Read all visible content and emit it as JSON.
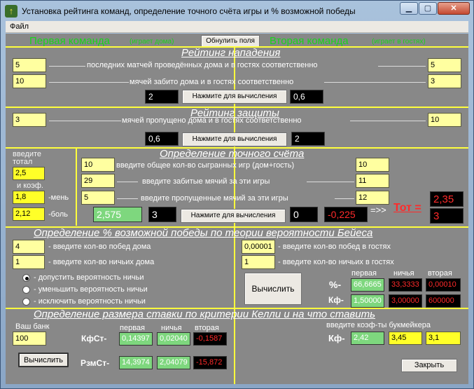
{
  "window": {
    "title": "Установка рейтинга команд, определение точного счёта игры и % возможной победы",
    "min_glyph": "▁",
    "max_glyph": "▢",
    "close_glyph": "✕"
  },
  "menu": {
    "file": "Файл"
  },
  "teams": {
    "first": "Первая команда",
    "first_note": "(играет дома)",
    "reset": "Обнулить поля",
    "second": "Вторая команда",
    "second_note": "(играет в гостях)"
  },
  "attack": {
    "title": "Рейтинг нападения",
    "matches_label": "последних матчей проведённых дома и в гостях соответственно",
    "goals_label": "мячей забито дома и в гостях соответственно",
    "home_matches": "5",
    "home_goals": "10",
    "away_matches": "5",
    "away_goals": "3",
    "result_home": "2",
    "result_away": "0,6",
    "calc_button": "Нажмите для вычисления"
  },
  "defense": {
    "title": "Рейтинг защиты",
    "conceded_label": "мячей пропущено дома и в гостях соответственно",
    "home_conceded": "3",
    "away_conceded": "10",
    "result_home": "0,6",
    "result_away": "2",
    "calc_button": "Нажмите для вычисления"
  },
  "score": {
    "title": "Определение точного счёта",
    "total_label_1": "введите",
    "total_label_2": "тотал",
    "total": "2,5",
    "coef_label": "и коэф.",
    "coef_less": "1,8",
    "less_label": "-мень",
    "coef_more": "2,12",
    "more_label": "-боль",
    "games_label": "введите общее кол-во сыгранных игр (дом+гость)",
    "scored_label": "введите  забитые мячий за эти игры",
    "conceded_label": "введите  пропущенные мячий за эти игры",
    "home_games": "10",
    "home_scored": "29",
    "home_conceded": "5",
    "away_games": "10",
    "away_scored": "11",
    "away_conceded": "12",
    "result_green": "2,575",
    "result_black": "3",
    "calc_button": "Нажмите для вычисления",
    "result_zero": "0",
    "result_red": "-0,225",
    "arrow": "=>>",
    "tot_label": "Тот =",
    "tot_value": "2,35",
    "tot_count": "3"
  },
  "bayes": {
    "title": "Определение % возможной победы по теории вероятности Бейеса",
    "home_wins_label": "- введите кол-во побед дома",
    "home_draws_label": "- введите кол-во ничьих дома",
    "away_wins_label": "- введите кол-во  побед в гостях",
    "away_draws_label": "- введите кол-во ничьих в гостях",
    "home_wins": "4",
    "home_draws": "1",
    "away_wins": "0,00001",
    "away_draws": "1",
    "radio_allow": "- допустить вероятность ничьи",
    "radio_reduce": "- уменьшить вероятность ничьи",
    "radio_exclude": "- исключить вероятность ничьи",
    "calc_button": "Вычислить",
    "col_first": "первая",
    "col_draw": "ничья",
    "col_second": "вторая",
    "row_pct": "%-",
    "row_kf": "Кф-",
    "pct_first": "66,6665",
    "pct_draw": "33,3333",
    "pct_second": "0,00010",
    "kf_first": "1,50000",
    "kf_draw": "3,00000",
    "kf_second": "600000"
  },
  "kelly": {
    "title": "Определение размера ставки по критерии Келли и на что ставить",
    "bank_label": "Ваш банк",
    "bank": "100",
    "calc_button": "Вычислить",
    "col_first": "первая",
    "col_draw": "ничья",
    "col_second": "вторая",
    "kfst_label": "КфСт-",
    "rzmst_label": "РзмСт-",
    "kfst_first": "0,14397",
    "kfst_draw": "0,02040",
    "kfst_second": "-0,1587",
    "rzm_first": "14,3974",
    "rzm_draw": "2,04079",
    "rzm_second": "-15,872",
    "bookmaker_label": "введите коэф-ты букмейкера",
    "kf_label": "Кф-",
    "bk_first": "2,42",
    "bk_draw": "3,45",
    "bk_second": "3,1",
    "close_button": "Закрыть"
  }
}
